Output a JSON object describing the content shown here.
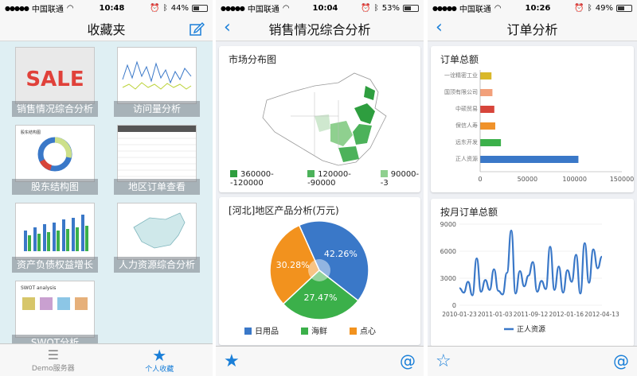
{
  "status": [
    {
      "carrier": "中国联通",
      "time": "10:48",
      "battery": "44%",
      "battery_level": 0.44
    },
    {
      "carrier": "中国联通",
      "time": "10:04",
      "battery": "53%",
      "battery_level": 0.53
    },
    {
      "carrier": "中国联通",
      "time": "10:26",
      "battery": "49%",
      "battery_level": 0.49
    }
  ],
  "favorites": {
    "title": "收藏夹",
    "tiles": [
      "销售情况综合分析",
      "访问量分析",
      "股东结构图",
      "地区订单查看",
      "资产负债权益增长",
      "人力资源综合分析",
      "SWOT分析"
    ],
    "thumb_texts": {
      "sale_word": "SALE",
      "swot": "SWOT analysis",
      "org": "股东结构图"
    },
    "tabs": [
      {
        "label": "Demo服务器",
        "active": false
      },
      {
        "label": "个人收藏",
        "active": true
      }
    ]
  },
  "sales": {
    "title": "销售情况综合分析",
    "map_card": {
      "title": "市场分布图",
      "legend": [
        {
          "label": "360000--120000",
          "color": "#2e9e3f"
        },
        {
          "label": "120000--90000",
          "color": "#4cb25a"
        },
        {
          "label": "90000--3",
          "color": "#8fd08f"
        }
      ]
    },
    "pie_card": {
      "title": "[河北]地区产品分析(万元)",
      "chart_data": {
        "type": "pie",
        "slices": [
          {
            "name": "日用品",
            "value": 42.26,
            "label": "42.26%",
            "color": "#3a78c8"
          },
          {
            "name": "海鲜",
            "value": 27.47,
            "label": "27.47%",
            "color": "#3bb04a"
          },
          {
            "name": "点心",
            "value": 30.28,
            "label": "30.28%",
            "color": "#f2921e"
          }
        ]
      }
    }
  },
  "orders": {
    "title": "订单分析",
    "bar_card": {
      "title": "订单总额",
      "chart_data": {
        "type": "bar",
        "orientation": "horizontal",
        "categories": [
          "一诠精密工业",
          "国顶有限公司",
          "中硕贸易",
          "保信人寿",
          "远东开发",
          "正人资源"
        ],
        "values": [
          12000,
          13000,
          15000,
          16000,
          22000,
          104000
        ],
        "colors": [
          "#d9b82a",
          "#f2a07a",
          "#d7453a",
          "#f0922a",
          "#3bb04a",
          "#3a78c8"
        ],
        "xlim": [
          0,
          150000
        ],
        "xticks": [
          "0",
          "50000",
          "100000",
          "150000"
        ]
      }
    },
    "line_card": {
      "title": "按月订单总额",
      "chart_data": {
        "type": "line",
        "x": [
          "2010-01-23",
          "2011-01-03",
          "2011-09-12",
          "2012-01-16",
          "2012-04-13"
        ],
        "series": [
          {
            "name": "正人资源",
            "values": [
              1900,
              1400,
              2600,
              1100,
              5200,
              1500,
              2800,
              1700,
              4000,
              1600,
              1200,
              3600,
              8300,
              1300,
              3800,
              2100,
              3300,
              4800,
              1500,
              2700,
              1800,
              6500,
              1700,
              4300,
              1400,
              3900,
              2600,
              5600,
              1300,
              6900,
              2500,
              6200,
              4100,
              5400
            ]
          }
        ],
        "ylim": [
          0,
          9000
        ],
        "yticks": [
          "9000",
          "6000",
          "3000",
          "0"
        ]
      }
    }
  },
  "bottom": {
    "star": "☆",
    "at": "@"
  }
}
